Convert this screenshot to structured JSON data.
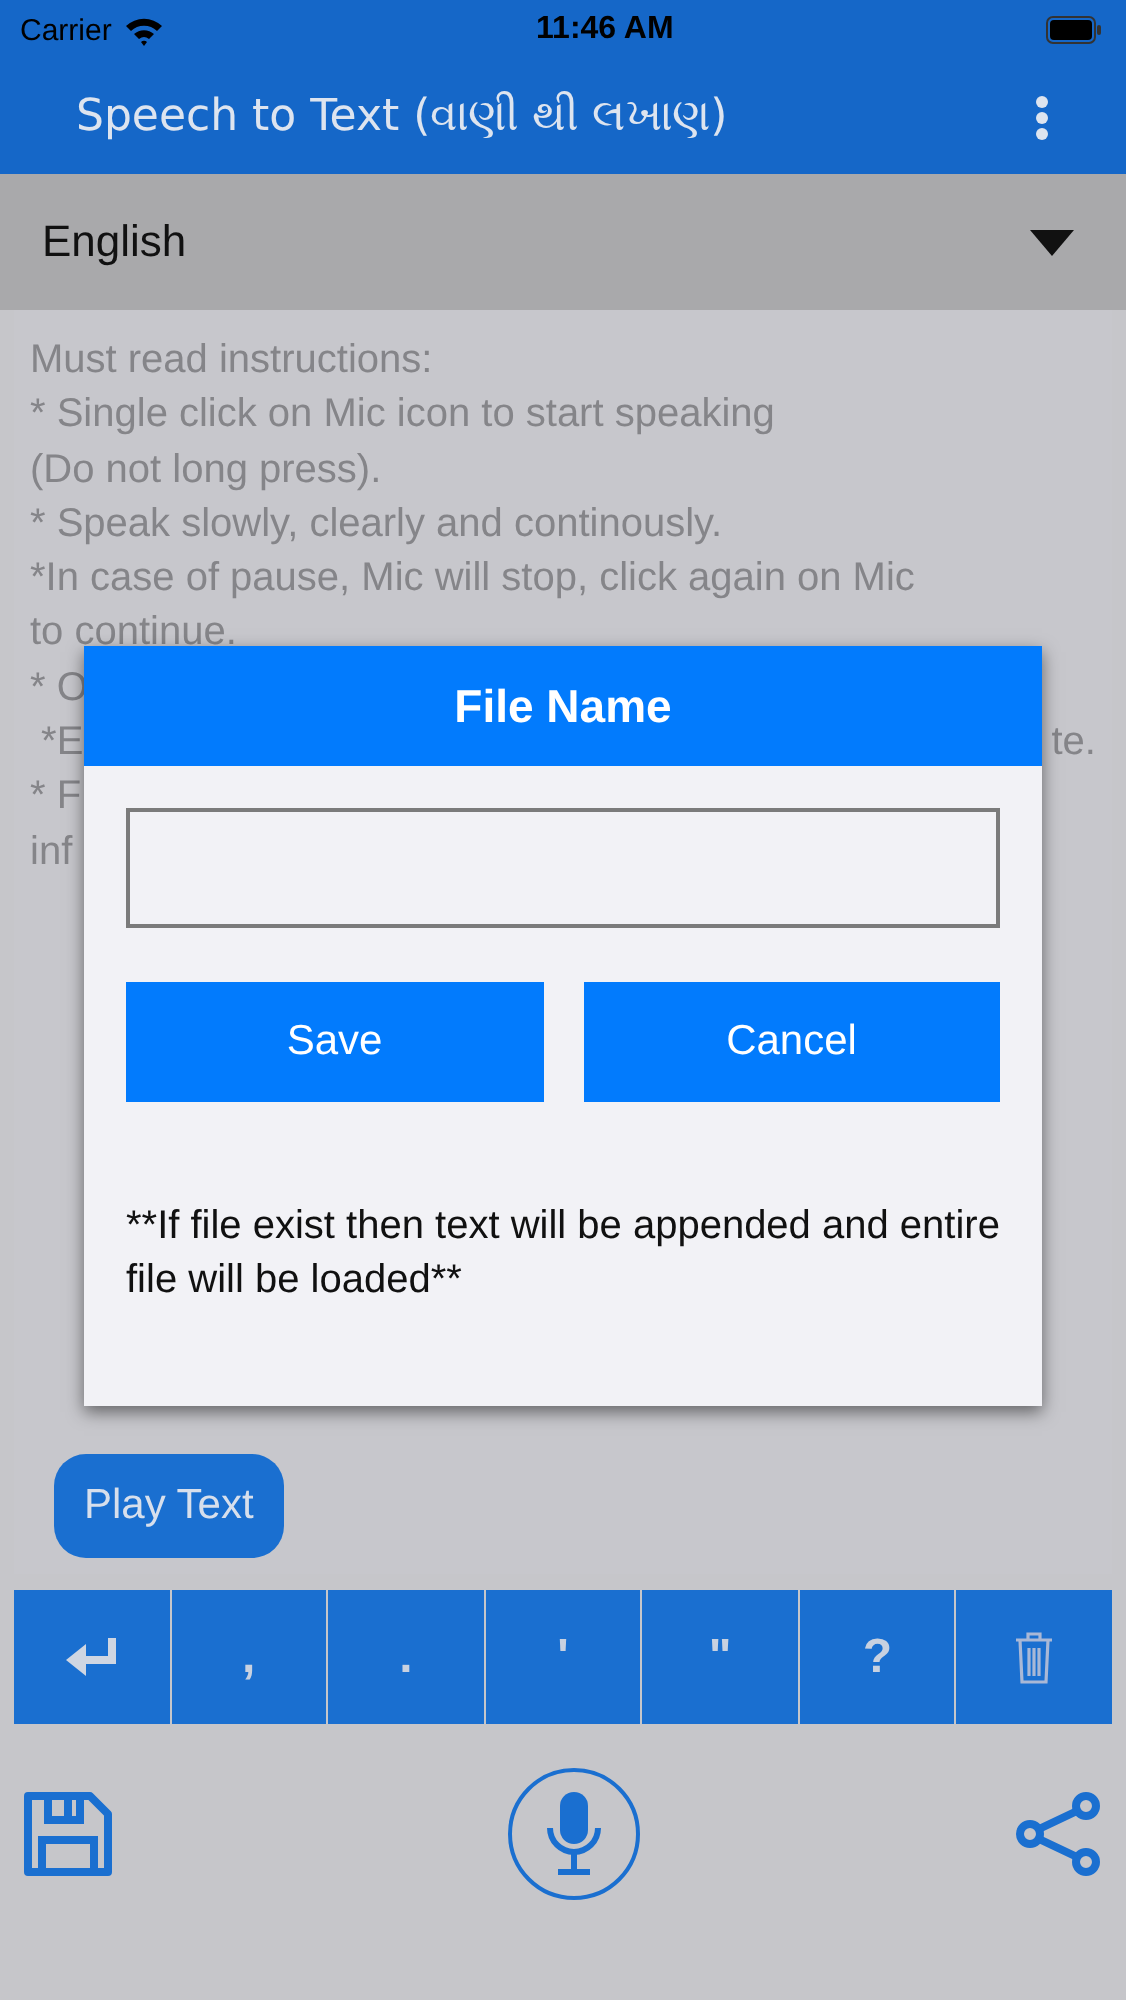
{
  "status_bar": {
    "carrier": "Carrier",
    "time": "11:46 AM"
  },
  "app_bar": {
    "title": "Speech to Text (વાણી થી લખાણ)"
  },
  "language": {
    "value": "English"
  },
  "instructions": [
    {
      "left": "Must read instructions:"
    },
    {
      "left": "* Single click on Mic icon to start speaking"
    },
    {
      "left": "(Do not long press)."
    },
    {
      "left": "* Speak slowly, clearly and continously."
    },
    {
      "left": "*In case of pause, Mic will stop, click again on Mic"
    },
    {
      "left": "to continue."
    },
    {
      "left": "* O"
    },
    {
      "left": " *E",
      "right": "te."
    },
    {
      "left": "* F"
    },
    {
      "left": "inf"
    }
  ],
  "play_button": "Play Text",
  "keys": [
    {
      "kind": "enter"
    },
    {
      "kind": "text",
      "label": ","
    },
    {
      "kind": "text",
      "label": "."
    },
    {
      "kind": "text",
      "label": "'"
    },
    {
      "kind": "text",
      "label": "\""
    },
    {
      "kind": "text",
      "label": "?"
    },
    {
      "kind": "trash"
    }
  ],
  "dialog": {
    "title": "File Name",
    "buttons": [
      "Save",
      "Cancel"
    ],
    "note": "**If file exist then text will be appended and entire file will be loaded**"
  }
}
